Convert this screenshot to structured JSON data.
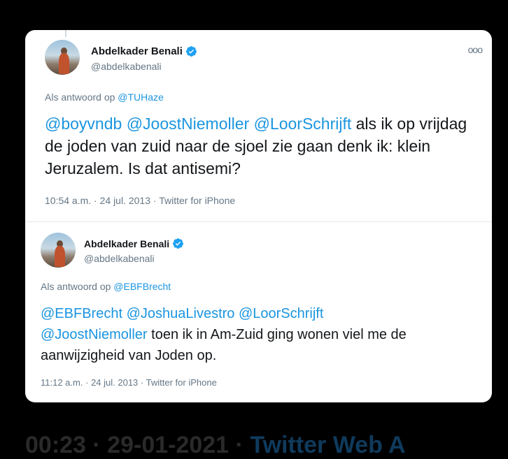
{
  "tweets": [
    {
      "author_name": "Abdelkader Benali",
      "author_handle": "@abdelkabenali",
      "reply_prefix": "Als antwoord op",
      "reply_to": "@TUHaze",
      "mentions_leading": [
        "@boyvndb",
        "@JoostNiemoller",
        "@LoorSchrijft"
      ],
      "text": "als ik op vrijdag de joden van zuid naar de sjoel zie gaan denk ik: klein Jeruzalem. Is dat antisemi?",
      "time": "10:54 a.m.",
      "date": "24 jul. 2013",
      "source": "Twitter for iPhone",
      "more_label": "ooo"
    },
    {
      "author_name": "Abdelkader Benali",
      "author_handle": "@abdelkabenali",
      "reply_prefix": "Als antwoord op",
      "reply_to": "@EBFBrecht",
      "mentions_leading": [
        "@EBFBrecht",
        "@JoshuaLivestro",
        "@LoorSchrijft",
        "@JoostNiemoller"
      ],
      "text": "toen ik in Am-Zuid ging wonen viel me de aanwijzigheid van Joden op.",
      "time": "11:12 a.m.",
      "date": "24 jul. 2013",
      "source": "Twitter for iPhone"
    }
  ],
  "meta_separator": "·",
  "footer": {
    "timestamp": "00:23 · 29-01-2021 ·",
    "source": "Twitter Web A"
  },
  "colors": {
    "background": "#000000",
    "card": "#ffffff",
    "link": "#1b95e0",
    "verified": "#1da1f2",
    "muted": "#657786"
  }
}
